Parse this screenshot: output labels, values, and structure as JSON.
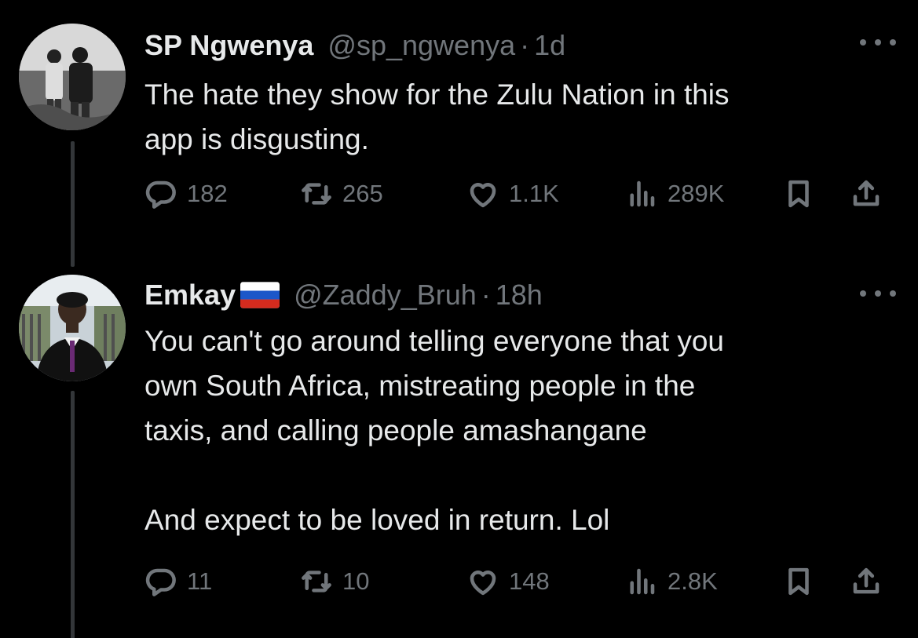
{
  "tweets": [
    {
      "author_name": "SP Ngwenya",
      "author_handle": "@sp_ngwenya",
      "separator": "·",
      "time": "1d",
      "text": "The hate they show for the Zulu Nation in this\napp is disgusting.",
      "flag_icon": "",
      "stats": {
        "replies": "182",
        "reposts": "265",
        "likes": "1.1K",
        "views": "289K"
      }
    },
    {
      "author_name": "Emkay",
      "flag_icon": "russia-flag-icon",
      "author_handle": "@Zaddy_Bruh",
      "separator": "·",
      "time": "18h",
      "text": "You can't go around telling everyone that you\nown South Africa, mistreating people in the\ntaxis, and calling people amashangane\n\nAnd expect to be loved in return. Lol",
      "stats": {
        "replies": "11",
        "reposts": "10",
        "likes": "148",
        "views": "2.8K"
      }
    }
  ],
  "colors": {
    "background": "#000000",
    "text_primary": "#e7e9ea",
    "text_secondary": "#71767b",
    "thread_line": "#333639"
  },
  "icons": [
    "reply-icon",
    "repost-icon",
    "like-icon",
    "views-icon",
    "bookmark-icon",
    "share-icon",
    "more-icon"
  ]
}
